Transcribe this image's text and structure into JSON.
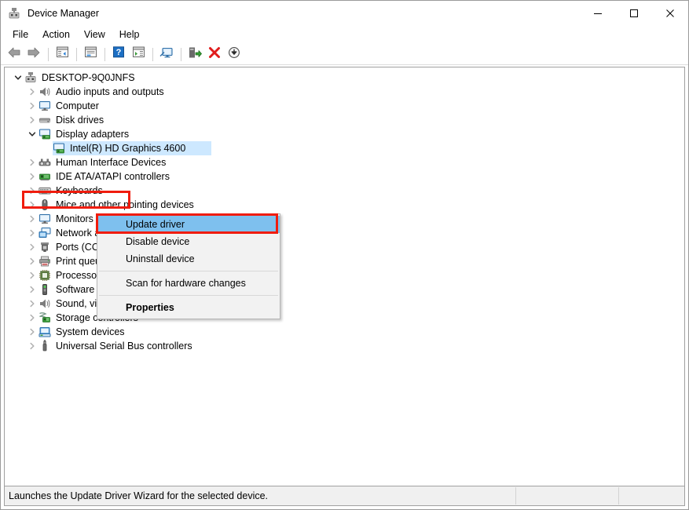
{
  "window": {
    "title": "Device Manager",
    "title_icon": "device-manager-icon",
    "caption": {
      "minimize": "minimize-icon",
      "maximize": "maximize-icon",
      "close": "close-icon"
    }
  },
  "menubar": {
    "items": [
      {
        "label": "File",
        "name": "menu-file"
      },
      {
        "label": "Action",
        "name": "menu-action"
      },
      {
        "label": "View",
        "name": "menu-view"
      },
      {
        "label": "Help",
        "name": "menu-help"
      }
    ]
  },
  "toolbar": {
    "buttons": [
      {
        "name": "back-button",
        "icon": "back-arrow-icon"
      },
      {
        "name": "forward-button",
        "icon": "forward-arrow-icon"
      },
      {
        "name": "show-hide-console-tree-button",
        "icon": "console-tree-icon"
      },
      {
        "name": "properties-button",
        "icon": "properties-window-icon"
      },
      {
        "name": "help-button",
        "icon": "question-mark-icon"
      },
      {
        "name": "show-hide-action-pane-button",
        "icon": "action-pane-icon"
      },
      {
        "name": "scan-for-hardware-changes-button",
        "icon": "monitor-scan-icon"
      },
      {
        "name": "update-driver-button",
        "icon": "update-driver-icon"
      },
      {
        "name": "uninstall-device-button",
        "icon": "red-x-icon"
      },
      {
        "name": "disable-device-button",
        "icon": "down-arrow-circle-icon"
      }
    ]
  },
  "tree": {
    "nodes": [
      {
        "label": "DESKTOP-9Q0JNFS",
        "level": 0,
        "state": "expanded",
        "icon": "computer-node-icon",
        "name": "tree-node-desktop"
      },
      {
        "label": "Audio inputs and outputs",
        "level": 1,
        "state": "collapsed",
        "icon": "speaker-icon",
        "name": "tree-node-audio-inputs-and-outputs"
      },
      {
        "label": "Computer",
        "level": 1,
        "state": "collapsed",
        "icon": "monitor-icon",
        "name": "tree-node-computer"
      },
      {
        "label": "Disk drives",
        "level": 1,
        "state": "collapsed",
        "icon": "disk-drive-icon",
        "name": "tree-node-disk-drives"
      },
      {
        "label": "Display adapters",
        "level": 1,
        "state": "expanded",
        "icon": "display-adapter-icon",
        "name": "tree-node-display-adapters"
      },
      {
        "label": "Intel(R) HD Graphics 4600",
        "level": 2,
        "state": "leaf",
        "icon": "display-adapter-icon",
        "name": "tree-node-intel-hd-graphics-4600",
        "selected": true
      },
      {
        "label": "Human Interface Devices",
        "level": 1,
        "state": "collapsed",
        "icon": "hid-icon",
        "name": "tree-node-human-interface-devices"
      },
      {
        "label": "IDE ATA/ATAPI controllers",
        "level": 1,
        "state": "collapsed",
        "icon": "ide-controller-icon",
        "name": "tree-node-ide-ata-atapi-controllers"
      },
      {
        "label": "Keyboards",
        "level": 1,
        "state": "collapsed",
        "icon": "keyboard-icon",
        "name": "tree-node-keyboards"
      },
      {
        "label": "Mice and other pointing devices",
        "level": 1,
        "state": "collapsed",
        "icon": "mouse-icon",
        "name": "tree-node-mice-and-other-pointing-devices"
      },
      {
        "label": "Monitors",
        "level": 1,
        "state": "collapsed",
        "icon": "monitor-icon",
        "name": "tree-node-monitors"
      },
      {
        "label": "Network adapters",
        "level": 1,
        "state": "collapsed",
        "icon": "network-adapter-icon",
        "name": "tree-node-network-adapters"
      },
      {
        "label": "Ports (COM & LPT)",
        "level": 1,
        "state": "collapsed",
        "icon": "port-icon",
        "name": "tree-node-ports"
      },
      {
        "label": "Print queues",
        "level": 1,
        "state": "collapsed",
        "icon": "printer-icon",
        "name": "tree-node-print-queues"
      },
      {
        "label": "Processors",
        "level": 1,
        "state": "collapsed",
        "icon": "processor-icon",
        "name": "tree-node-processors"
      },
      {
        "label": "Software devices",
        "level": 1,
        "state": "collapsed",
        "icon": "software-device-icon",
        "name": "tree-node-software-devices"
      },
      {
        "label": "Sound, video and game controllers",
        "level": 1,
        "state": "collapsed",
        "icon": "speaker-icon",
        "name": "tree-node-sound-video-and-game-controllers"
      },
      {
        "label": "Storage controllers",
        "level": 1,
        "state": "collapsed",
        "icon": "storage-controller-icon",
        "name": "tree-node-storage-controllers"
      },
      {
        "label": "System devices",
        "level": 1,
        "state": "collapsed",
        "icon": "system-device-icon",
        "name": "tree-node-system-devices"
      },
      {
        "label": "Universal Serial Bus controllers",
        "level": 1,
        "state": "collapsed",
        "icon": "usb-icon",
        "name": "tree-node-universal-serial-bus-controllers"
      }
    ]
  },
  "context_menu": {
    "items": [
      {
        "label": "Update driver",
        "name": "context-menu-update-driver",
        "highlighted": true
      },
      {
        "label": "Disable device",
        "name": "context-menu-disable-device"
      },
      {
        "label": "Uninstall device",
        "name": "context-menu-uninstall-device"
      },
      {
        "separator": true,
        "name": "context-menu-separator-1"
      },
      {
        "label": "Scan for hardware changes",
        "name": "context-menu-scan-for-hardware-changes"
      },
      {
        "separator": true,
        "name": "context-menu-separator-2"
      },
      {
        "label": "Properties",
        "name": "context-menu-properties",
        "bold": true
      }
    ]
  },
  "statusbar": {
    "message": "Launches the Update Driver Wizard for the selected device.",
    "pane2": "",
    "pane3": ""
  },
  "annotations": {
    "color": "#f01c0d",
    "boxes": [
      {
        "name": "annotation-box-display-adapters"
      },
      {
        "name": "annotation-box-update-driver"
      }
    ]
  }
}
